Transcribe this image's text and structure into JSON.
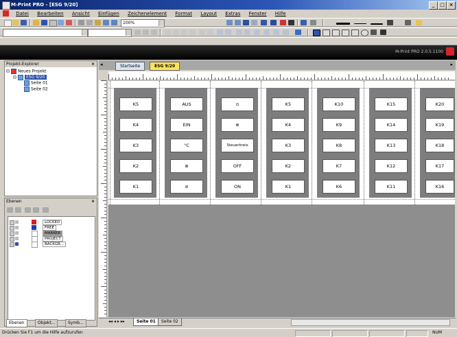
{
  "window": {
    "title": "M-Print PRO - [ESG 9/20]",
    "buttons": [
      "_",
      "□",
      "×"
    ]
  },
  "menu": {
    "items": [
      "Datei",
      "Bearbeiten",
      "Ansicht",
      "Einfügen",
      "Zeichenelement",
      "Format",
      "Layout",
      "Extras",
      "Fenster",
      "Hilfe"
    ]
  },
  "toolbar": {
    "zoom": "100%"
  },
  "darkband": {
    "version": "M-Print PRO 2.0.5.1100"
  },
  "project_explorer": {
    "title": "Projekt-Explorer",
    "close": "×",
    "tree": {
      "root": "Neues Projekt",
      "document": "ESG 9/20",
      "pages": [
        "Seite 01",
        "Seite 02"
      ]
    }
  },
  "layers": {
    "title": "Ebenen",
    "close": "×",
    "rows": [
      {
        "name": "LOCKED",
        "color": "#d81e28"
      },
      {
        "name": "FREE",
        "color": "#1c3fa8"
      },
      {
        "name": "MARKER",
        "color": "#ffffff"
      },
      {
        "name": "PROJECT",
        "color": "#ffffff"
      },
      {
        "name": "BACKGR...",
        "color": "#ffffff"
      }
    ],
    "tabs": [
      "Ebenen",
      "Objekt...",
      "Symb..."
    ]
  },
  "document": {
    "tabs": [
      "Startseite",
      "ESG 9/20"
    ],
    "strips": [
      [
        "K5",
        "K4",
        "K3",
        "K2",
        "K1"
      ],
      [
        "AUS",
        "EIN",
        "°C",
        "⊕",
        "⊘"
      ],
      [
        "⊙",
        "⊕",
        "Steuerkreis",
        "OFF",
        "ON"
      ],
      [
        "K5",
        "K4",
        "K3",
        "K2",
        "K1"
      ],
      [
        "K10",
        "K9",
        "K8",
        "K7",
        "K6"
      ],
      [
        "K15",
        "K14",
        "K13",
        "K12",
        "K11"
      ],
      [
        "K20",
        "K19",
        "K18",
        "K17",
        "K16"
      ]
    ],
    "page_tabs": [
      "Seite 01",
      "Seite 02"
    ]
  },
  "statusbar": {
    "text": "Drücken Sie F1 um die Hilfe aufzurufen",
    "right": "NUM"
  }
}
